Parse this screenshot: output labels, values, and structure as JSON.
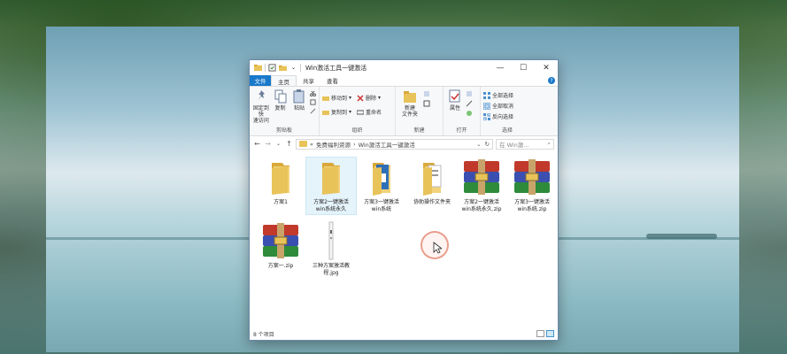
{
  "window": {
    "title": "Win激活工具一键激活",
    "controls": {
      "minimize": "—",
      "maximize": "☐",
      "close": "✕"
    }
  },
  "ribbon_tabs": [
    "文件",
    "主页",
    "共享",
    "查看"
  ],
  "help_label": "?",
  "ribbon": {
    "clipboard": {
      "pin": "固定到快\n速访问",
      "copy": "复制",
      "paste": "粘贴",
      "label": "剪贴板"
    },
    "organize": {
      "move_to": "移动到",
      "copy_to": "复制到",
      "delete": "删除",
      "rename": "重命名",
      "label": "组织"
    },
    "new": {
      "new_folder": "新建\n文件夹",
      "label": "新建"
    },
    "open": {
      "properties": "属性",
      "label": "打开"
    },
    "select": {
      "select_all": "全部选择",
      "select_none": "全部取消",
      "invert": "反向选择",
      "label": "选择"
    }
  },
  "address": {
    "back": "←",
    "forward": "→",
    "dropdown": "⌄",
    "up": "↑",
    "crumb_prefix": "«",
    "crumbs": [
      "免费福利资源",
      "Win激活工具一键激活"
    ],
    "refresh": "↻",
    "search_placeholder": "在 Win激...",
    "search_icon": "⌕"
  },
  "files": [
    {
      "name": "方案1",
      "type": "folder"
    },
    {
      "name": "方案2一键激活\nwin系统永久",
      "type": "folder",
      "selected": true
    },
    {
      "name": "方案3一键激活\nwin系统",
      "type": "folder-blue"
    },
    {
      "name": "协助操作文件夹",
      "type": "folder-doc"
    },
    {
      "name": "方案2一键激活\nwin系统永久.zip",
      "type": "zip"
    },
    {
      "name": "方案3一键激活\nwin系统.zip",
      "type": "zip"
    },
    {
      "name": "方案一.zip",
      "type": "zip"
    },
    {
      "name": "三种方案激活教\n程.jpg",
      "type": "image"
    }
  ],
  "status": {
    "item_count": "8 个项目"
  },
  "colors": {
    "accent": "#1979ca",
    "folder": "#e8c35a",
    "selection": "#e5f3fb"
  }
}
